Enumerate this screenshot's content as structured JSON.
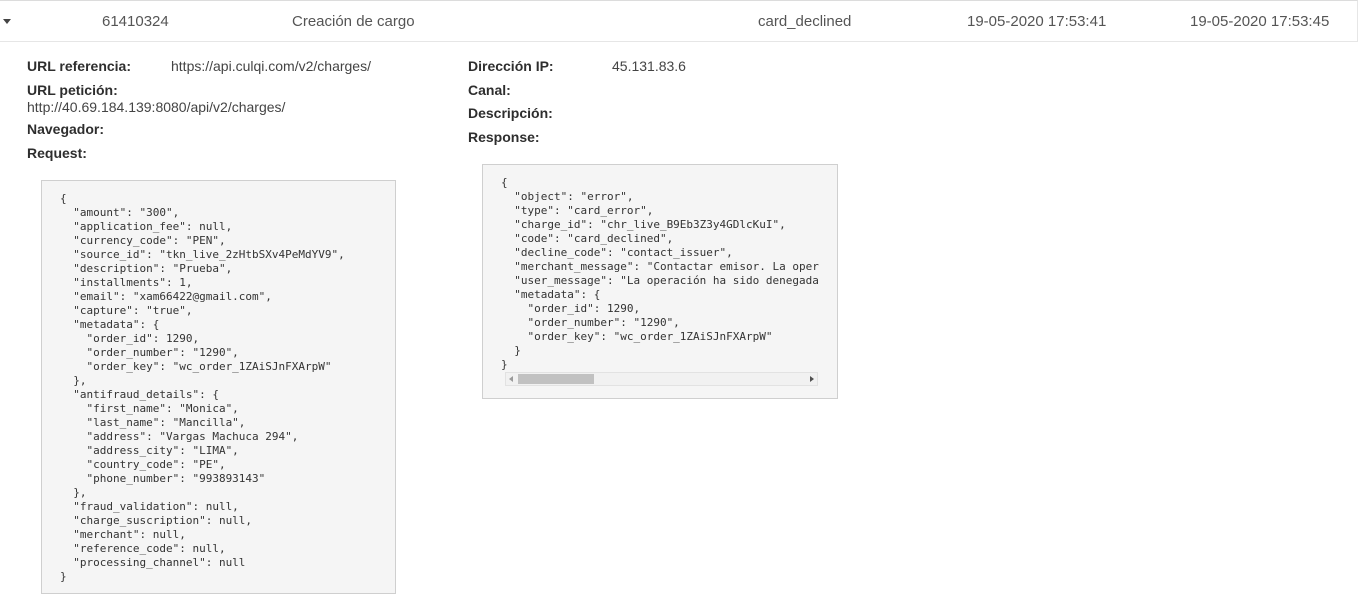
{
  "row": {
    "id": "61410324",
    "type": "Creación de cargo",
    "status": "card_declined",
    "created_at": "19-05-2020 17:53:41",
    "updated_at": "19-05-2020 17:53:45"
  },
  "details": {
    "url_referencia_label": "URL referencia:",
    "url_referencia_value": "https://api.culqi.com/v2/charges/",
    "url_peticion_label": "URL petición:",
    "url_peticion_value": "http://40.69.184.139:8080/api/v2/charges/",
    "navegador_label": "Navegador:",
    "request_label": "Request:",
    "direccion_ip_label": "Dirección IP:",
    "direccion_ip_value": "45.131.83.6",
    "canal_label": "Canal:",
    "descripcion_label": "Descripción:",
    "response_label": "Response:"
  },
  "request_json": "{\n  \"amount\": \"300\",\n  \"application_fee\": null,\n  \"currency_code\": \"PEN\",\n  \"source_id\": \"tkn_live_2zHtbSXv4PeMdYV9\",\n  \"description\": \"Prueba\",\n  \"installments\": 1,\n  \"email\": \"xam66422@gmail.com\",\n  \"capture\": \"true\",\n  \"metadata\": {\n    \"order_id\": 1290,\n    \"order_number\": \"1290\",\n    \"order_key\": \"wc_order_1ZAiSJnFXArpW\"\n  },\n  \"antifraud_details\": {\n    \"first_name\": \"Monica\",\n    \"last_name\": \"Mancilla\",\n    \"address\": \"Vargas Machuca 294\",\n    \"address_city\": \"LIMA\",\n    \"country_code\": \"PE\",\n    \"phone_number\": \"993893143\"\n  },\n  \"fraud_validation\": null,\n  \"charge_suscription\": null,\n  \"merchant\": null,\n  \"reference_code\": null,\n  \"processing_channel\": null\n}",
  "response_json": "{\n  \"object\": \"error\",\n  \"type\": \"card_error\",\n  \"charge_id\": \"chr_live_B9Eb3Z3y4GDlcKuI\",\n  \"code\": \"card_declined\",\n  \"decline_code\": \"contact_issuer\",\n  \"merchant_message\": \"Contactar emisor. La operac\n  \"user_message\": \"La operación ha sido denegada p\n  \"metadata\": {\n    \"order_id\": 1290,\n    \"order_number\": \"1290\",\n    \"order_key\": \"wc_order_1ZAiSJnFXArpW\"\n  }\n}",
  "icons": {
    "row_toggle": "caret-down-icon",
    "scroll_left": "arrow-left-icon",
    "scroll_right": "arrow-right-icon"
  }
}
